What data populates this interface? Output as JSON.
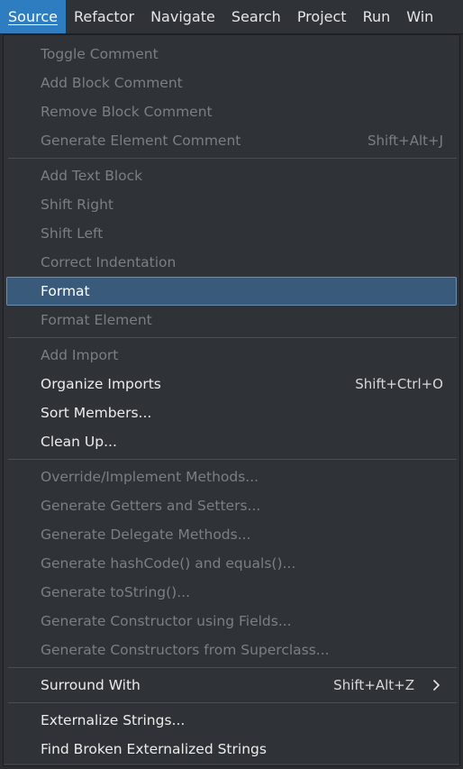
{
  "menubar": {
    "items": [
      {
        "label": "Source",
        "active": true
      },
      {
        "label": "Refactor",
        "active": false
      },
      {
        "label": "Navigate",
        "active": false
      },
      {
        "label": "Search",
        "active": false
      },
      {
        "label": "Project",
        "active": false
      },
      {
        "label": "Run",
        "active": false
      },
      {
        "label": "Win",
        "active": false
      }
    ]
  },
  "menu": {
    "groups": [
      {
        "items": [
          {
            "label": "Toggle Comment",
            "enabled": false
          },
          {
            "label": "Add Block Comment",
            "enabled": false
          },
          {
            "label": "Remove Block Comment",
            "enabled": false
          },
          {
            "label": "Generate Element Comment",
            "enabled": false,
            "shortcut": "Shift+Alt+J"
          }
        ]
      },
      {
        "items": [
          {
            "label": "Add Text Block",
            "enabled": false
          },
          {
            "label": "Shift Right",
            "enabled": false
          },
          {
            "label": "Shift Left",
            "enabled": false
          },
          {
            "label": "Correct Indentation",
            "enabled": false
          },
          {
            "label": "Format",
            "enabled": true,
            "selected": true
          },
          {
            "label": "Format Element",
            "enabled": false
          }
        ]
      },
      {
        "items": [
          {
            "label": "Add Import",
            "enabled": false
          },
          {
            "label": "Organize Imports",
            "enabled": true,
            "shortcut": "Shift+Ctrl+O"
          },
          {
            "label": "Sort Members...",
            "enabled": true
          },
          {
            "label": "Clean Up...",
            "enabled": true
          }
        ]
      },
      {
        "items": [
          {
            "label": "Override/Implement Methods...",
            "enabled": false
          },
          {
            "label": "Generate Getters and Setters...",
            "enabled": false
          },
          {
            "label": "Generate Delegate Methods...",
            "enabled": false
          },
          {
            "label": "Generate hashCode() and equals()...",
            "enabled": false
          },
          {
            "label": "Generate toString()...",
            "enabled": false
          },
          {
            "label": "Generate Constructor using Fields...",
            "enabled": false
          },
          {
            "label": "Generate Constructors from Superclass...",
            "enabled": false
          }
        ]
      },
      {
        "items": [
          {
            "label": "Surround With",
            "enabled": true,
            "shortcut": "Shift+Alt+Z",
            "submenu": true
          }
        ]
      },
      {
        "items": [
          {
            "label": "Externalize Strings...",
            "enabled": true
          },
          {
            "label": "Find Broken Externalized Strings",
            "enabled": true
          }
        ]
      }
    ]
  },
  "colors": {
    "menubar_active": "#2e7dc0",
    "selection_fill": "#395a7a",
    "selection_border": "#6a8fb3",
    "disabled_text": "#7b7e83",
    "enabled_text": "#ececec"
  },
  "icons": {
    "submenu": "chevron-right-icon"
  }
}
